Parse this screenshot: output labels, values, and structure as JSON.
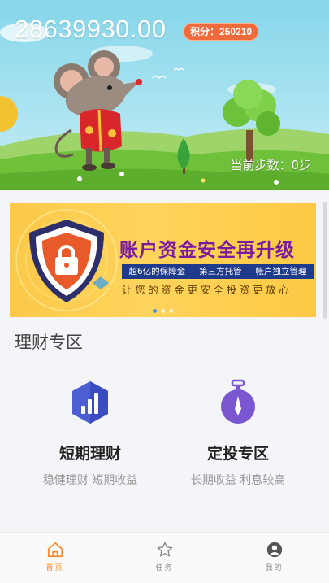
{
  "hero": {
    "balance": "28639930.00",
    "points_label": "积分：250210",
    "steps_label": "当前步数：0步"
  },
  "banner": {
    "title": "账户资金安全再升级",
    "features": [
      "超6亿的保障金",
      "第三方托管",
      "帐户独立管理"
    ],
    "slogan": "让您的资金更安全投资更放心",
    "active_slide": 1,
    "slide_count": 3
  },
  "section": {
    "title": "理财专区",
    "products": [
      {
        "name": "短期理财",
        "desc": "稳健理财 短期收益",
        "icon": "bar-chart-hexagon-icon"
      },
      {
        "name": "定投专区",
        "desc": "长期收益 利息较高",
        "icon": "stopwatch-icon"
      }
    ]
  },
  "tabbar": {
    "items": [
      {
        "label": "首页",
        "icon": "home-icon",
        "active": true
      },
      {
        "label": "任务",
        "icon": "star-icon",
        "active": false
      },
      {
        "label": "我的",
        "icon": "user-icon",
        "active": false
      }
    ]
  },
  "colors": {
    "accent": "#ff8a2a",
    "badge": "#f06a3c",
    "banner_title": "#7a1aa0",
    "product_icon_1": "#4b5fd1",
    "product_icon_2": "#7a57d1"
  }
}
